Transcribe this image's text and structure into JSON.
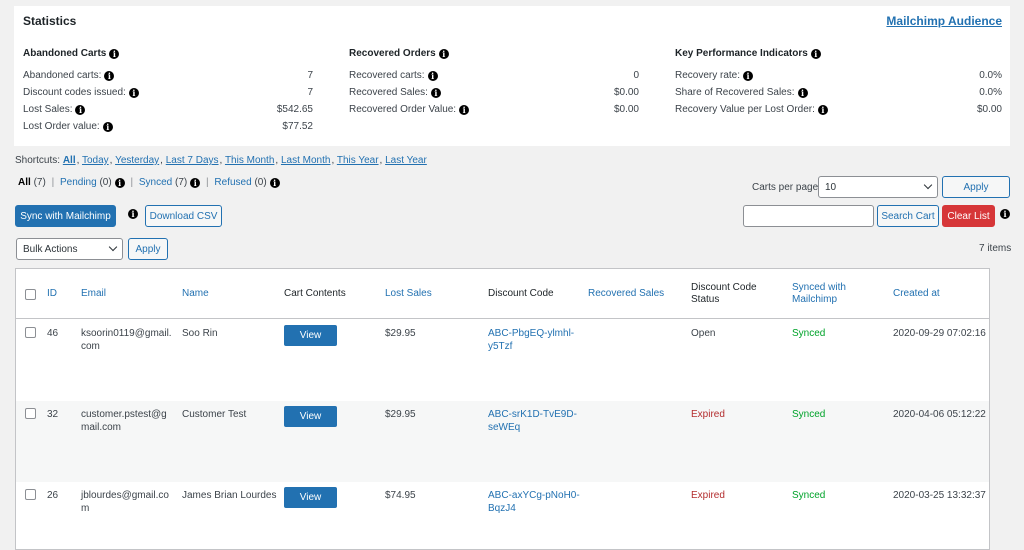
{
  "stats": {
    "title": "Statistics",
    "audience_link": "Mailchimp Audience",
    "abandoned": {
      "heading": "Abandoned Carts",
      "rows": [
        {
          "label": "Abandoned carts:",
          "value": "7"
        },
        {
          "label": "Discount codes issued:",
          "value": "7"
        },
        {
          "label": "Lost Sales:",
          "value": "$542.65"
        },
        {
          "label": "Lost Order value:",
          "value": "$77.52"
        }
      ]
    },
    "recovered": {
      "heading": "Recovered Orders",
      "rows": [
        {
          "label": "Recovered carts:",
          "value": "0"
        },
        {
          "label": "Recovered Sales:",
          "value": "$0.00"
        },
        {
          "label": "Recovered Order Value:",
          "value": "$0.00"
        }
      ]
    },
    "kpi": {
      "heading": "Key Performance Indicators",
      "rows": [
        {
          "label": "Recovery rate:",
          "value": "0.0%"
        },
        {
          "label": "Share of Recovered Sales:",
          "value": "0.0%"
        },
        {
          "label": "Recovery Value per Lost Order:",
          "value": "$0.00"
        }
      ]
    }
  },
  "shortcuts": {
    "label": "Shortcuts:",
    "items": [
      "All",
      "Today",
      "Yesterday",
      "Last 7 Days",
      "This Month",
      "Last Month",
      "This Year",
      "Last Year"
    ]
  },
  "filters": {
    "all": "All",
    "all_count": "(7)",
    "pending": "Pending",
    "pending_count": "(0)",
    "synced": "Synced",
    "synced_count": "(7)",
    "refused": "Refused",
    "refused_count": "(0)",
    "separator": "|"
  },
  "toolbar": {
    "sync_label": "Sync with Mailchimp",
    "download_label": "Download CSV",
    "carts_per_page_label": "Carts per page:",
    "carts_per_page_value": "10",
    "apply_label": "Apply",
    "search_value": "",
    "search_button": "Search Cart",
    "clear_label": "Clear List",
    "bulk_actions_value": "Bulk Actions",
    "bulk_apply_label": "Apply",
    "items_count": "7 items"
  },
  "table": {
    "columns": {
      "id": "ID",
      "email": "Email",
      "name": "Name",
      "cart_contents": "Cart Contents",
      "lost_sales": "Lost Sales",
      "discount_code": "Discount Code",
      "recovered_sales": "Recovered Sales",
      "discount_status_1": "Discount Code",
      "discount_status_2": "Status",
      "synced_1": "Synced with",
      "synced_2": "Mailchimp",
      "created_at": "Created at"
    },
    "view_label": "View",
    "rows": [
      {
        "id": "46",
        "email_1": "ksoorin0119@gmail.",
        "email_2": "com",
        "name": "Soo Rin",
        "lost_sales": "$29.95",
        "code_1": "ABC-PbgEQ-ylmhl-",
        "code_2": "y5Tzf",
        "recovered": "",
        "status": "Open",
        "synced": "Synced",
        "created": "2020-09-29 07:02:16"
      },
      {
        "id": "32",
        "email_1": "customer.pstest@g",
        "email_2": "mail.com",
        "name": "Customer Test",
        "lost_sales": "$29.95",
        "code_1": "ABC-srK1D-TvE9D-",
        "code_2": "seWEq",
        "recovered": "",
        "status": "Expired",
        "synced": "Synced",
        "created": "2020-04-06 05:12:22"
      },
      {
        "id": "26",
        "email_1": "jblourdes@gmail.co",
        "email_2": "m",
        "name": "James Brian Lourdes",
        "lost_sales": "$74.95",
        "code_1": "ABC-axYCg-pNoH0-",
        "code_2": "BqzJ4",
        "recovered": "",
        "status": "Expired",
        "synced": "Synced",
        "created": "2020-03-25 13:32:37"
      }
    ]
  },
  "colors": {
    "accent": "#2271b1",
    "danger": "#d63638",
    "expired": "#b32d2e",
    "synced": "#00a32a"
  },
  "icons": {
    "info": "info-icon",
    "dropdown": "chevron-down-icon"
  }
}
